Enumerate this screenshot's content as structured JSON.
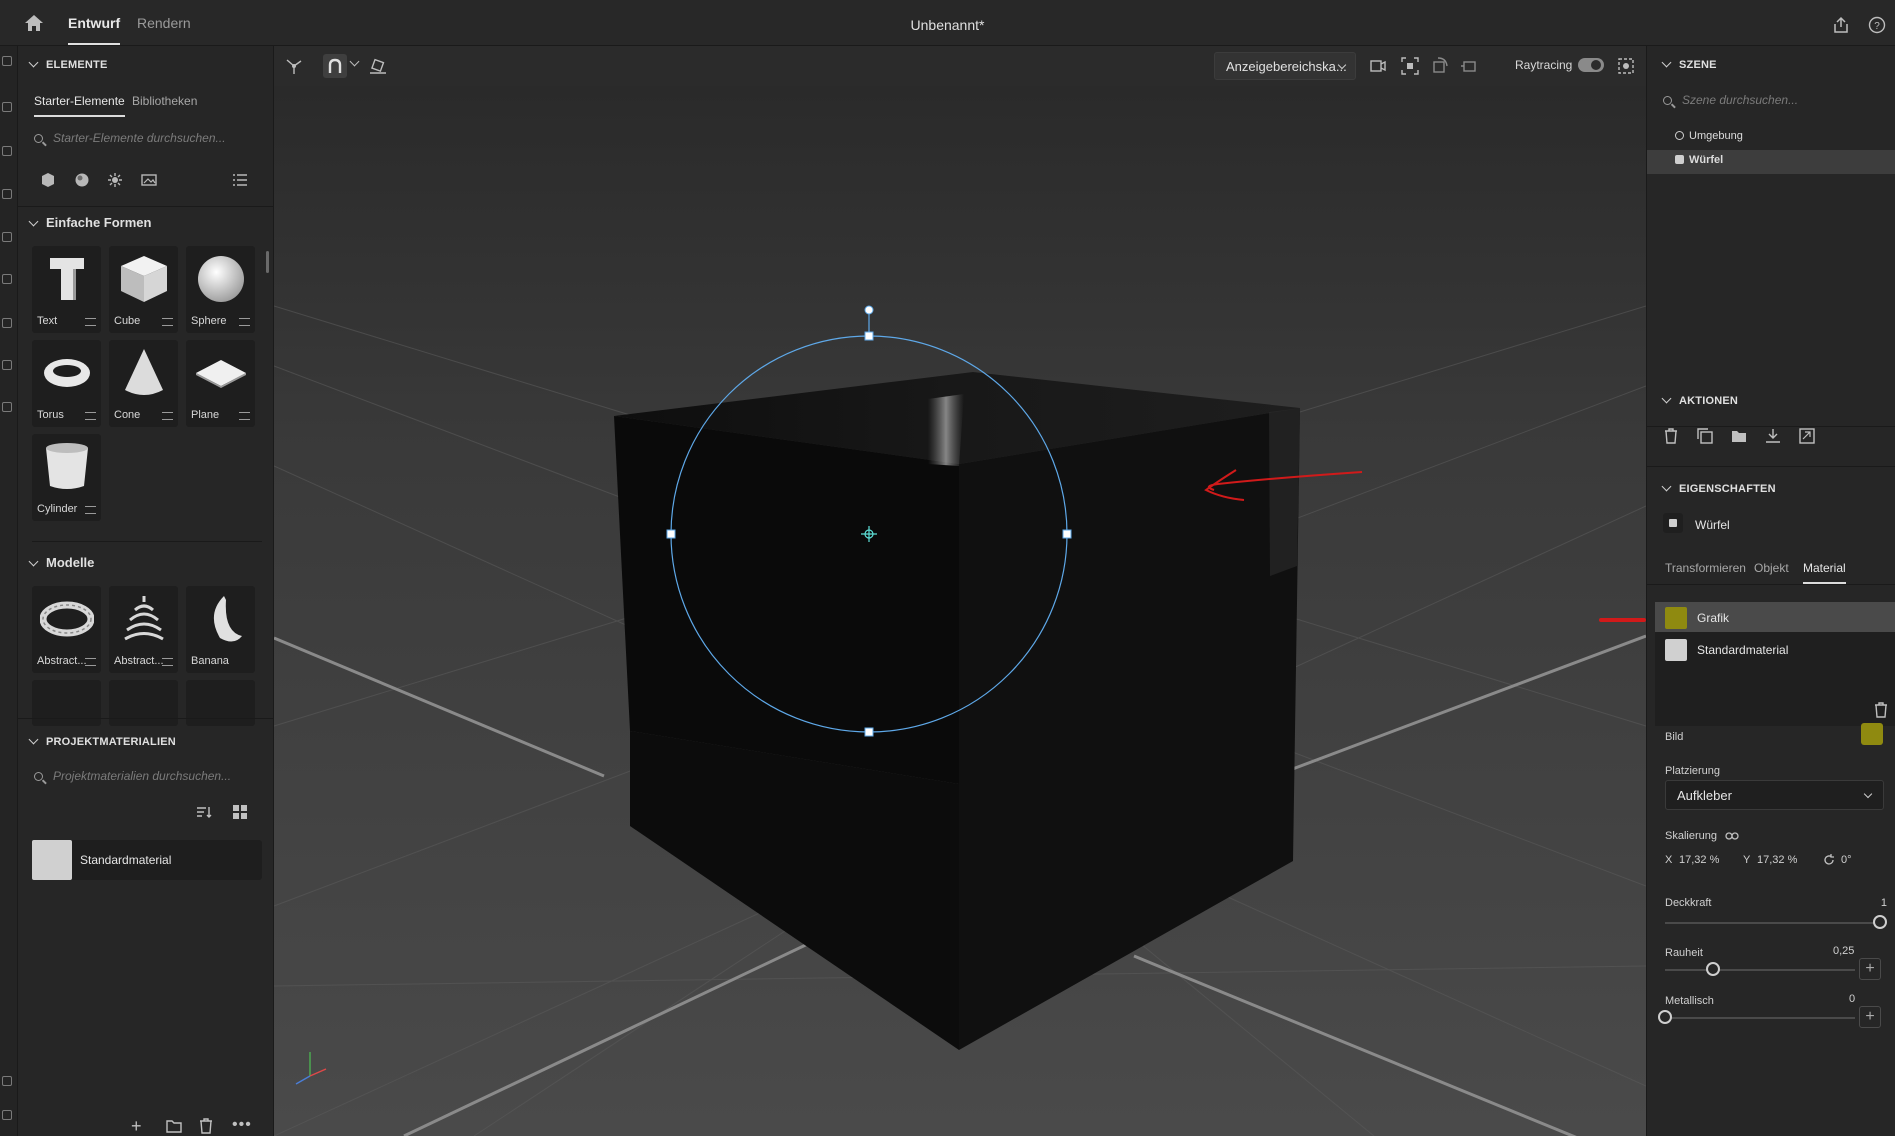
{
  "app": {
    "tabs": [
      {
        "label": "Entwurf",
        "active": true
      },
      {
        "label": "Rendern",
        "active": false
      }
    ],
    "document_title": "Unbenannt*"
  },
  "left_panel": {
    "elements": {
      "title": "ELEMENTE",
      "tabs": [
        {
          "label": "Starter-Elemente",
          "active": true
        },
        {
          "label": "Bibliotheken",
          "active": false
        }
      ],
      "search_placeholder": "Starter-Elemente durchsuchen...",
      "groups": [
        {
          "title": "Einfache Formen",
          "items": [
            "Text",
            "Cube",
            "Sphere",
            "Torus",
            "Cone",
            "Plane",
            "Cylinder"
          ]
        },
        {
          "title": "Modelle",
          "items": [
            "Abstract...",
            "Abstract...",
            "Banana"
          ]
        }
      ]
    },
    "project_materials": {
      "title": "PROJEKTMATERIALIEN",
      "search_placeholder": "Projektmaterialien durchsuchen...",
      "items": [
        {
          "name": "Standardmaterial"
        }
      ]
    }
  },
  "viewport": {
    "display_select": "Anzeigebereichska...",
    "raytracing_label": "Raytracing",
    "raytracing_on": true
  },
  "right_panel": {
    "scene": {
      "title": "SZENE",
      "search_placeholder": "Szene durchsuchen...",
      "items": [
        {
          "label": "Umgebung",
          "selected": false
        },
        {
          "label": "Würfel",
          "selected": true
        }
      ]
    },
    "actions": {
      "title": "AKTIONEN"
    },
    "properties": {
      "title": "EIGENSCHAFTEN",
      "object_name": "Würfel",
      "tabs": [
        {
          "label": "Transformieren",
          "active": false
        },
        {
          "label": "Objekt",
          "active": false
        },
        {
          "label": "Material",
          "active": true
        }
      ],
      "materials": [
        {
          "name": "Grafik",
          "selected": true
        },
        {
          "name": "Standardmaterial",
          "selected": false
        }
      ],
      "image_label": "Bild",
      "image_color": "#8f8a10",
      "placement_label": "Platzierung",
      "placement_value": "Aufkleber",
      "scaling_label": "Skalierung",
      "scale_x_label": "X",
      "scale_x": "17,32 %",
      "scale_y_label": "Y",
      "scale_y": "17,32 %",
      "rotation": "0°",
      "opacity": {
        "label": "Deckkraft",
        "value": "1",
        "fraction": 1.0
      },
      "roughness": {
        "label": "Rauheit",
        "value": "0,25",
        "fraction": 0.25
      },
      "metallic": {
        "label": "Metallisch",
        "value": "0",
        "fraction": 0.0
      }
    }
  },
  "colors": {
    "accent_selection": "#5ea8e8",
    "annotation": "#d11a1a"
  }
}
